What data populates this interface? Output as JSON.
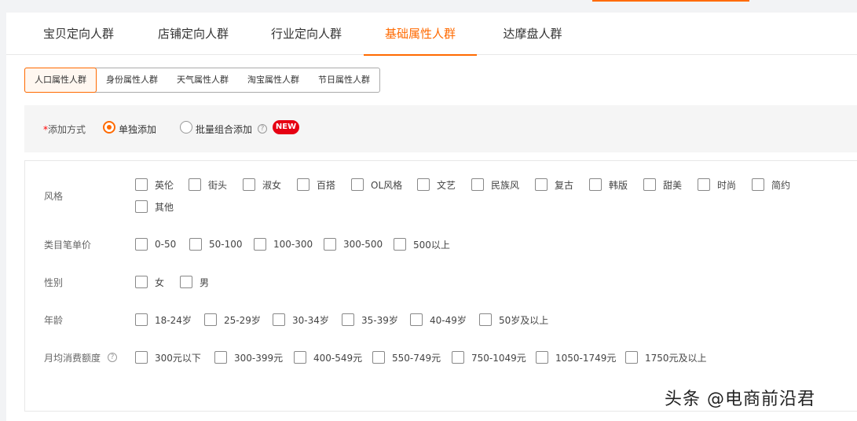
{
  "tabs": [
    {
      "label": "宝贝定向人群",
      "active": false
    },
    {
      "label": "店铺定向人群",
      "active": false
    },
    {
      "label": "行业定向人群",
      "active": false
    },
    {
      "label": "基础属性人群",
      "active": true
    },
    {
      "label": "达摩盘人群",
      "active": false
    }
  ],
  "subtabs": [
    {
      "label": "人口属性人群",
      "active": true
    },
    {
      "label": "身份属性人群",
      "active": false
    },
    {
      "label": "天气属性人群",
      "active": false
    },
    {
      "label": "淘宝属性人群",
      "active": false
    },
    {
      "label": "节日属性人群",
      "active": false
    }
  ],
  "add_method": {
    "required_mark": "*",
    "label": "添加方式",
    "options": [
      {
        "label": "单独添加",
        "selected": true
      },
      {
        "label": "批量组合添加",
        "selected": false
      }
    ],
    "help": "?",
    "badge": "NEW"
  },
  "filters": {
    "style": {
      "label": "风格",
      "options": [
        "英伦",
        "街头",
        "淑女",
        "百搭",
        "OL风格",
        "文艺",
        "民族风",
        "复古",
        "韩版",
        "甜美",
        "时尚",
        "简约",
        "其他"
      ]
    },
    "price": {
      "label": "类目笔单价",
      "options": [
        "0-50",
        "50-100",
        "100-300",
        "300-500",
        "500以上"
      ]
    },
    "gender": {
      "label": "性别",
      "options": [
        "女",
        "男"
      ]
    },
    "age": {
      "label": "年龄",
      "options": [
        "18-24岁",
        "25-29岁",
        "30-34岁",
        "35-39岁",
        "40-49岁",
        "50岁及以上"
      ]
    },
    "spend": {
      "label": "月均消费额度",
      "help": "?",
      "options": [
        "300元以下",
        "300-399元",
        "400-549元",
        "550-749元",
        "750-1049元",
        "1050-1749元",
        "1750元及以上"
      ]
    }
  },
  "watermark": "头条 @电商前沿君",
  "colors": {
    "accent": "#ff6a00",
    "badge": "#e60012"
  }
}
